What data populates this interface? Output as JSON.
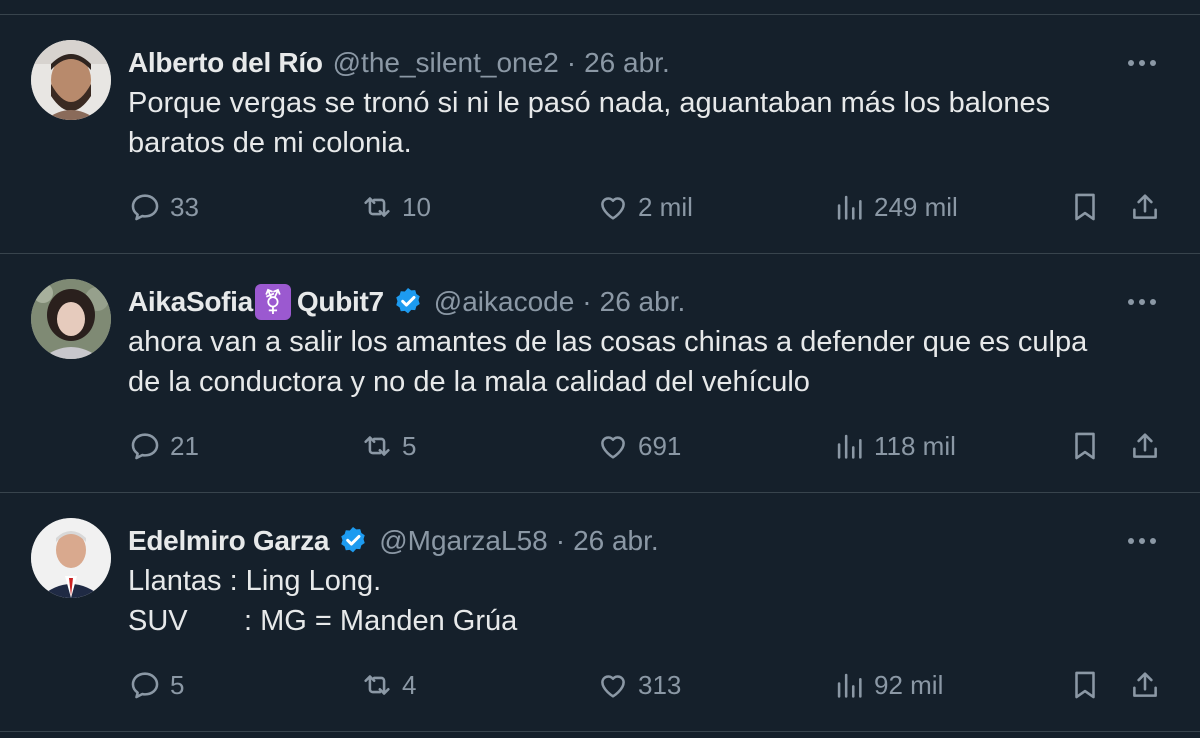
{
  "tweets": [
    {
      "name": "Alberto del Río",
      "emoji": "",
      "verified": false,
      "handle": "@the_silent_one2",
      "dot": "·",
      "date": "26 abr.",
      "text": "Porque vergas se tronó si ni le pasó nada, aguantaban más los balones\nbaratos de mi colonia.",
      "replies": "33",
      "retweets": "10",
      "likes": "2 mil",
      "views": "249 mil"
    },
    {
      "name": "AikaSofia",
      "emoji": "⚧",
      "name_suffix": "Qubit7",
      "verified": true,
      "handle": "@aikacode",
      "dot": "·",
      "date": "26 abr.",
      "text": "ahora van a salir los amantes de las cosas chinas a defender que es culpa\nde la conductora y no de la mala calidad del vehículo",
      "replies": "21",
      "retweets": "5",
      "likes": "691",
      "views": "118 mil"
    },
    {
      "name": "Edelmiro Garza",
      "emoji": "",
      "verified": true,
      "handle": "@MgarzaL58",
      "dot": "·",
      "date": "26 abr.",
      "text": "Llantas : Ling Long.\nSUV       : MG = Manden Grúa",
      "replies": "5",
      "retweets": "4",
      "likes": "313",
      "views": "92 mil"
    }
  ],
  "icons": {
    "more": "more-icon",
    "reply": "reply-icon",
    "retweet": "retweet-icon",
    "like": "heart-icon",
    "views": "views-icon",
    "bookmark": "bookmark-icon",
    "share": "share-icon",
    "verified": "verified-badge-icon"
  },
  "colors": {
    "background": "#15202b",
    "border": "#38444d",
    "text": "#e7e9ea",
    "muted": "#8b98a5",
    "verified": "#1d9bf0",
    "emoji_badge": "#9b59d0"
  }
}
